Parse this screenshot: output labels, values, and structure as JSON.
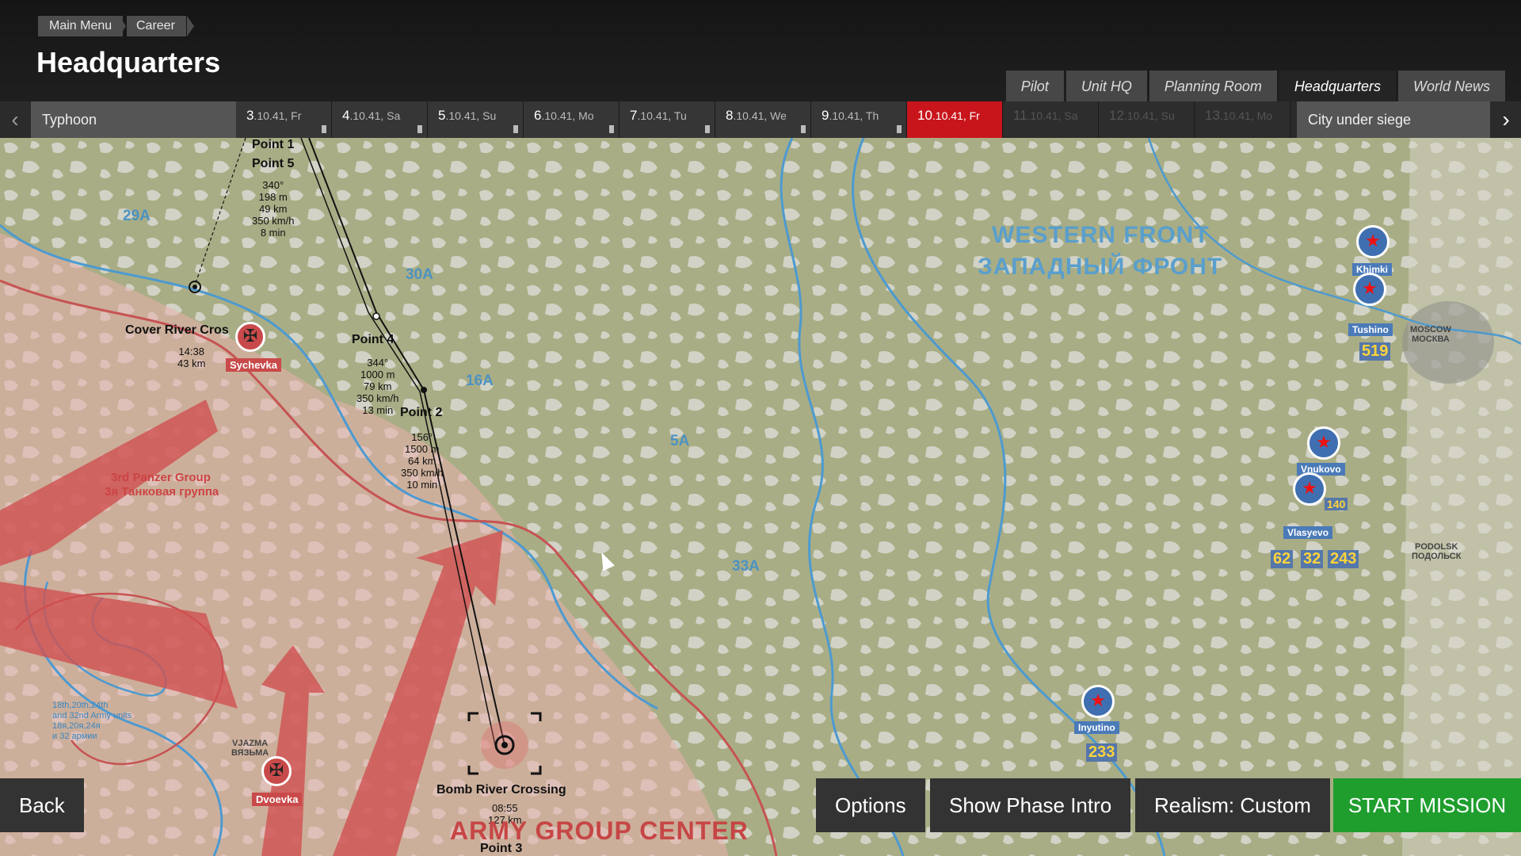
{
  "breadcrumbs": {
    "main": "Main Menu",
    "career": "Career"
  },
  "title": "Headquarters",
  "tabs": [
    "Pilot",
    "Unit HQ",
    "Planning Room",
    "Headquarters",
    "World News"
  ],
  "active_tab": "Headquarters",
  "timeline": {
    "campaign": "Typhoon",
    "phase": "City under siege",
    "days": [
      {
        "num": "3",
        "rest": ".10.41, Fr"
      },
      {
        "num": "4",
        "rest": ".10.41, Sa"
      },
      {
        "num": "5",
        "rest": ".10.41, Su"
      },
      {
        "num": "6",
        "rest": ".10.41, Mo"
      },
      {
        "num": "7",
        "rest": ".10.41, Tu"
      },
      {
        "num": "8",
        "rest": ".10.41, We"
      },
      {
        "num": "9",
        "rest": ".10.41, Th"
      },
      {
        "num": "10",
        "rest": ".10.41, Fr"
      },
      {
        "num": "11",
        "rest": ".10.41, Sa"
      },
      {
        "num": "12",
        "rest": ".10.41, Su"
      },
      {
        "num": "13",
        "rest": ".10.41, Mo"
      }
    ],
    "current_day": "10"
  },
  "map": {
    "front_en": "WESTERN FRONT",
    "front_ru": "ЗАПАДНЫЙ ФРОНТ",
    "army_group": "ARMY GROUP CENTER",
    "panzer_en": "3rd Panzer Group",
    "panzer_ru": "3я Танковая группа",
    "moscow": "MOSCOW\nМОСКВА",
    "podolsk": "PODOLSK\nПОДОЛЬСК",
    "vyazma": "VJAZMA\nВЯЗЬМА",
    "armies_note": "18th,20th,24th\nand 32nd Army units\n18я,20я,24я\nи 32 армии",
    "regions": [
      "29A",
      "30A",
      "16A",
      "5A",
      "33A"
    ],
    "waypoints": {
      "p1": "Point 1",
      "p5": "Point 5",
      "p5_info": "340°\n198 m\n49 km\n350 km/h\n8 min",
      "p4": "Point 4",
      "p4_info": "344°\n1000 m\n79 km\n350 km/h\n13 min",
      "p2": "Point 2",
      "p2_info": "156°\n1500 m\n64 km\n350 km/h\n10 min",
      "p3": "Point 3",
      "cover": "Cover River Cros",
      "cover_info": "14:38\n43 km",
      "target": "Bomb River Crossing",
      "target_info": "08:55\n127 km"
    },
    "enemy_airfields": [
      "Sychevka",
      "Dvoevka"
    ],
    "airfields": {
      "khimki": "Khimki",
      "tushino": "Tushino",
      "tushino_count": "519",
      "vnukovo": "Vnukovo",
      "vnukovo_count": "140",
      "vlasyevo": "Vlasyevo",
      "vlasyevo_counts": [
        "62",
        "32",
        "243"
      ],
      "inyutino": "Inyutino",
      "inyutino_count": "233"
    }
  },
  "buttons": {
    "back": "Back",
    "options": "Options",
    "intro": "Show Phase Intro",
    "realism": "Realism: Custom",
    "start": "START MISSION"
  },
  "colors": {
    "accent_red": "#c8151c",
    "start_green": "#1f9e2e",
    "map_base": "#a9ad8a"
  }
}
